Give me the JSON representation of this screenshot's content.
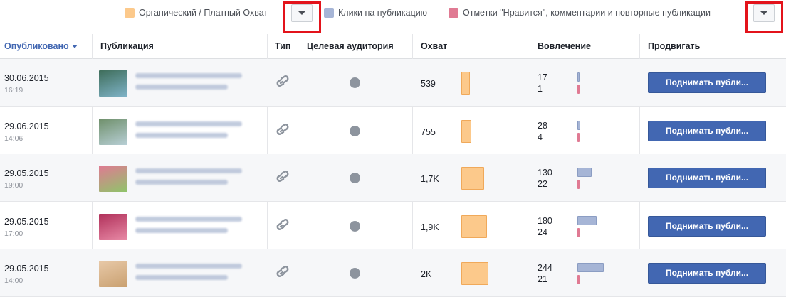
{
  "legend": {
    "items": [
      {
        "label": "Органический / Платный Охват",
        "color": "#fcc98b"
      },
      {
        "label": "Клики на публикацию",
        "color": "#a6b5d6"
      },
      {
        "label": "Отметки \"Нравится\", комментарии и повторные публикации",
        "color": "#e07a93"
      }
    ],
    "dropdown_icon": "chevron-down-icon"
  },
  "table": {
    "headers": {
      "published": "Опубликовано",
      "post": "Публикация",
      "type": "Тип",
      "audience": "Целевая аудитория",
      "reach": "Охват",
      "engagement": "Вовлечение",
      "promote": "Продвигать"
    },
    "rows": [
      {
        "date": "30.06.2015",
        "time": "16:19",
        "type_icon": "link-icon",
        "audience_icon": "globe-icon",
        "reach": "539",
        "reach_level": 539,
        "engagement": {
          "clicks": "17",
          "likes": "1"
        },
        "promote_label": "Поднимать публи...",
        "thumb_colors": [
          "#3e6d5a",
          "#7fb3c8"
        ]
      },
      {
        "date": "29.06.2015",
        "time": "14:06",
        "type_icon": "link-icon",
        "audience_icon": "globe-icon",
        "reach": "755",
        "reach_level": 755,
        "engagement": {
          "clicks": "28",
          "likes": "4"
        },
        "promote_label": "Поднимать публи...",
        "thumb_colors": [
          "#6e8f6a",
          "#b8cfd6"
        ]
      },
      {
        "date": "29.05.2015",
        "time": "19:00",
        "type_icon": "link-icon",
        "audience_icon": "globe-icon",
        "reach": "1,7K",
        "reach_level": 1700,
        "engagement": {
          "clicks": "130",
          "likes": "22"
        },
        "promote_label": "Поднимать публи...",
        "thumb_colors": [
          "#e07a93",
          "#8fc46a"
        ]
      },
      {
        "date": "29.05.2015",
        "time": "17:00",
        "type_icon": "link-icon",
        "audience_icon": "globe-icon",
        "reach": "1,9K",
        "reach_level": 1900,
        "engagement": {
          "clicks": "180",
          "likes": "24"
        },
        "promote_label": "Поднимать публи...",
        "thumb_colors": [
          "#b0305a",
          "#e88aa6"
        ]
      },
      {
        "date": "29.05.2015",
        "time": "14:00",
        "type_icon": "link-icon",
        "audience_icon": "globe-icon",
        "reach": "2K",
        "reach_level": 2000,
        "engagement": {
          "clicks": "244",
          "likes": "21"
        },
        "promote_label": "Поднимать публи...",
        "thumb_colors": [
          "#e8c9a8",
          "#c9a070"
        ]
      }
    ]
  }
}
